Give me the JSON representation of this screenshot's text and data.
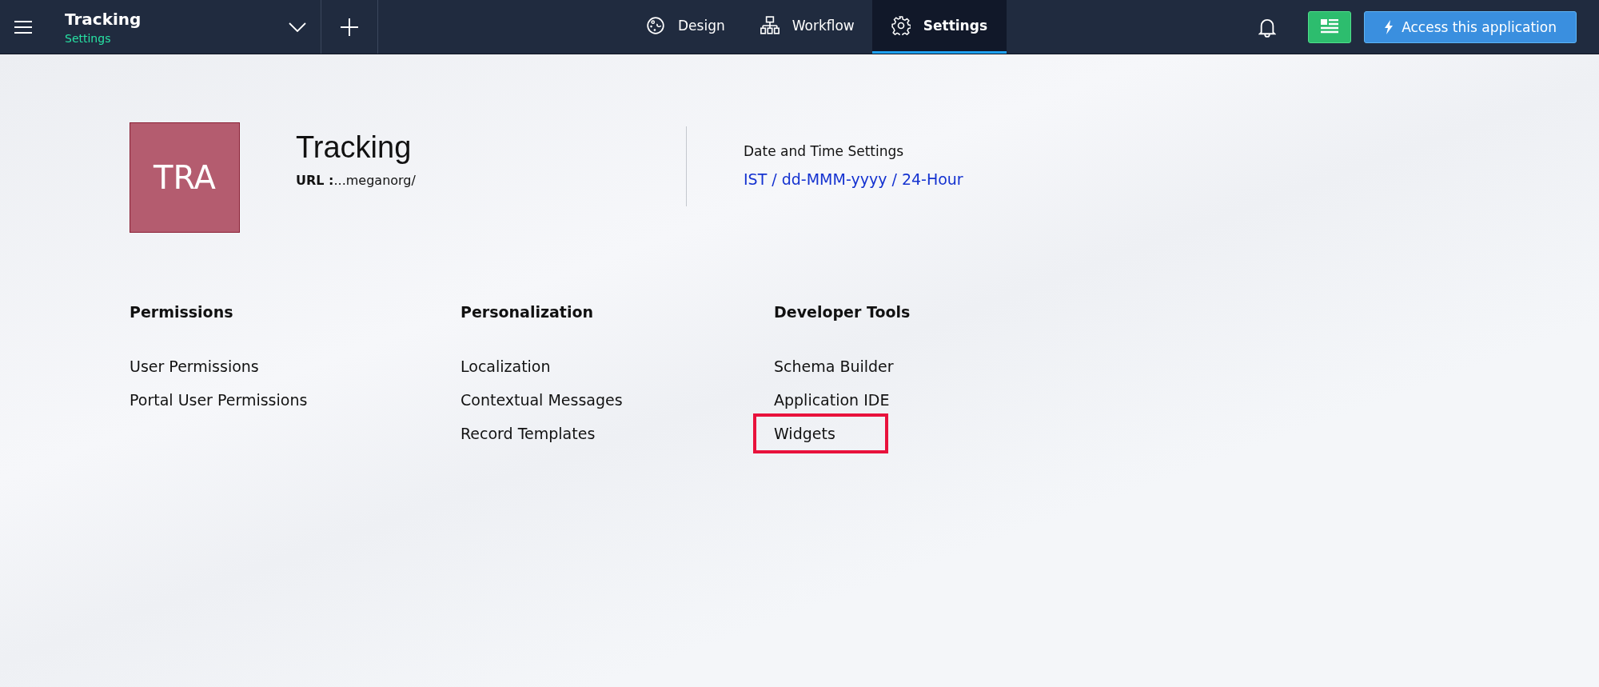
{
  "topbar": {
    "app_name": "Tracking",
    "app_subtitle": "Settings",
    "tabs": [
      {
        "label": "Design",
        "selected": false
      },
      {
        "label": "Workflow",
        "selected": false
      },
      {
        "label": "Settings",
        "selected": true
      }
    ],
    "access_button": "Access this application"
  },
  "app": {
    "logo_text": "TRA",
    "title": "Tracking",
    "url": "**URL :**...meganorg/",
    "datetime_label": "Date and Time Settings",
    "datetime_value": "IST / dd-MMM-yyyy / 24-Hour"
  },
  "sections": [
    {
      "heading": "Permissions",
      "items": [
        {
          "label": "User Permissions",
          "highlighted": false
        },
        {
          "label": "Portal User Permissions",
          "highlighted": false
        }
      ]
    },
    {
      "heading": "Personalization",
      "items": [
        {
          "label": "Localization",
          "highlighted": false
        },
        {
          "label": "Contextual Messages",
          "highlighted": false
        },
        {
          "label": "Record Templates",
          "highlighted": false
        }
      ]
    },
    {
      "heading": "Developer Tools",
      "items": [
        {
          "label": "Schema Builder",
          "highlighted": false
        },
        {
          "label": "Application IDE",
          "highlighted": false
        },
        {
          "label": "Widgets",
          "highlighted": true
        }
      ]
    }
  ]
}
